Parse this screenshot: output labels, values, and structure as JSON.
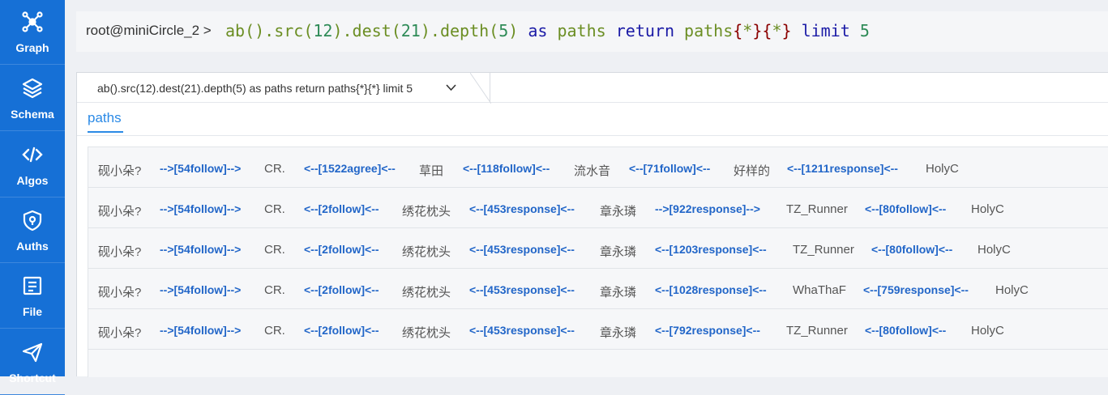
{
  "sidebar": {
    "items": [
      {
        "label": "Graph",
        "icon": "graph-icon"
      },
      {
        "label": "Schema",
        "icon": "layers-icon"
      },
      {
        "label": "Algos",
        "icon": "code-icon"
      },
      {
        "label": "Auths",
        "icon": "shield-icon"
      },
      {
        "label": "File",
        "icon": "file-icon"
      },
      {
        "label": "Shortcut",
        "icon": "send-icon"
      }
    ]
  },
  "console": {
    "prompt": "root@miniCircle_2 >",
    "query": {
      "fn1": "ab().src(",
      "n1": "12",
      "fn2": ").dest(",
      "n2": "21",
      "fn3": ").depth(",
      "n3": "5",
      "fn4": ")",
      "kw1": "as",
      "v1": "paths",
      "kw2": "return",
      "v2": "paths",
      "b1": "{",
      "s1": "*",
      "b2": "}",
      "b3": "{",
      "s2": "*",
      "b4": "}",
      "kw3": "limit",
      "n4": "5"
    }
  },
  "result_tab": {
    "label": "ab().src(12).dest(21).depth(5) as paths return paths{*}{*} limit 5"
  },
  "subtab": {
    "label": "paths"
  },
  "colors": {
    "sidebar": "#1670d6",
    "accent": "#2b8ae6",
    "edge": "#2266c8"
  },
  "rows": [
    {
      "cells": [
        {
          "t": "node",
          "v": "砚小朵?"
        },
        {
          "t": "edge",
          "v": "-->[54follow]-->"
        },
        {
          "t": "node",
          "v": "CR."
        },
        {
          "t": "edge",
          "v": "<--[1522agree]<--"
        },
        {
          "t": "node",
          "v": "草田"
        },
        {
          "t": "edge",
          "v": "<--[118follow]<--"
        },
        {
          "t": "node",
          "v": "流水音"
        },
        {
          "t": "edge",
          "v": "<--[71follow]<--"
        },
        {
          "t": "node",
          "v": "好样的"
        },
        {
          "t": "edge",
          "v": "<--[1211response]<--"
        },
        {
          "t": "node",
          "v": "HolyC"
        }
      ]
    },
    {
      "cells": [
        {
          "t": "node",
          "v": "砚小朵?"
        },
        {
          "t": "edge",
          "v": "-->[54follow]-->"
        },
        {
          "t": "node",
          "v": "CR."
        },
        {
          "t": "edge",
          "v": "<--[2follow]<--"
        },
        {
          "t": "node",
          "v": "绣花枕头"
        },
        {
          "t": "edge",
          "v": "<--[453response]<--"
        },
        {
          "t": "node",
          "v": "章永璘"
        },
        {
          "t": "edge",
          "v": "-->[922response]-->"
        },
        {
          "t": "node",
          "v": "TZ_Runner"
        },
        {
          "t": "edge",
          "v": "<--[80follow]<--"
        },
        {
          "t": "node",
          "v": "HolyC"
        }
      ]
    },
    {
      "cells": [
        {
          "t": "node",
          "v": "砚小朵?"
        },
        {
          "t": "edge",
          "v": "-->[54follow]-->"
        },
        {
          "t": "node",
          "v": "CR."
        },
        {
          "t": "edge",
          "v": "<--[2follow]<--"
        },
        {
          "t": "node",
          "v": "绣花枕头"
        },
        {
          "t": "edge",
          "v": "<--[453response]<--"
        },
        {
          "t": "node",
          "v": "章永璘"
        },
        {
          "t": "edge",
          "v": "<--[1203response]<--"
        },
        {
          "t": "node",
          "v": "TZ_Runner"
        },
        {
          "t": "edge",
          "v": "<--[80follow]<--"
        },
        {
          "t": "node",
          "v": "HolyC"
        }
      ]
    },
    {
      "cells": [
        {
          "t": "node",
          "v": "砚小朵?"
        },
        {
          "t": "edge",
          "v": "-->[54follow]-->"
        },
        {
          "t": "node",
          "v": "CR."
        },
        {
          "t": "edge",
          "v": "<--[2follow]<--"
        },
        {
          "t": "node",
          "v": "绣花枕头"
        },
        {
          "t": "edge",
          "v": "<--[453response]<--"
        },
        {
          "t": "node",
          "v": "章永璘"
        },
        {
          "t": "edge",
          "v": "<--[1028response]<--"
        },
        {
          "t": "node",
          "v": "WhaThaF"
        },
        {
          "t": "edge",
          "v": "<--[759response]<--"
        },
        {
          "t": "node",
          "v": "HolyC"
        }
      ]
    },
    {
      "cells": [
        {
          "t": "node",
          "v": "砚小朵?"
        },
        {
          "t": "edge",
          "v": "-->[54follow]-->"
        },
        {
          "t": "node",
          "v": "CR."
        },
        {
          "t": "edge",
          "v": "<--[2follow]<--"
        },
        {
          "t": "node",
          "v": "绣花枕头"
        },
        {
          "t": "edge",
          "v": "<--[453response]<--"
        },
        {
          "t": "node",
          "v": "章永璘"
        },
        {
          "t": "edge",
          "v": "<--[792response]<--"
        },
        {
          "t": "node",
          "v": "TZ_Runner"
        },
        {
          "t": "edge",
          "v": "<--[80follow]<--"
        },
        {
          "t": "node",
          "v": "HolyC"
        }
      ]
    }
  ]
}
